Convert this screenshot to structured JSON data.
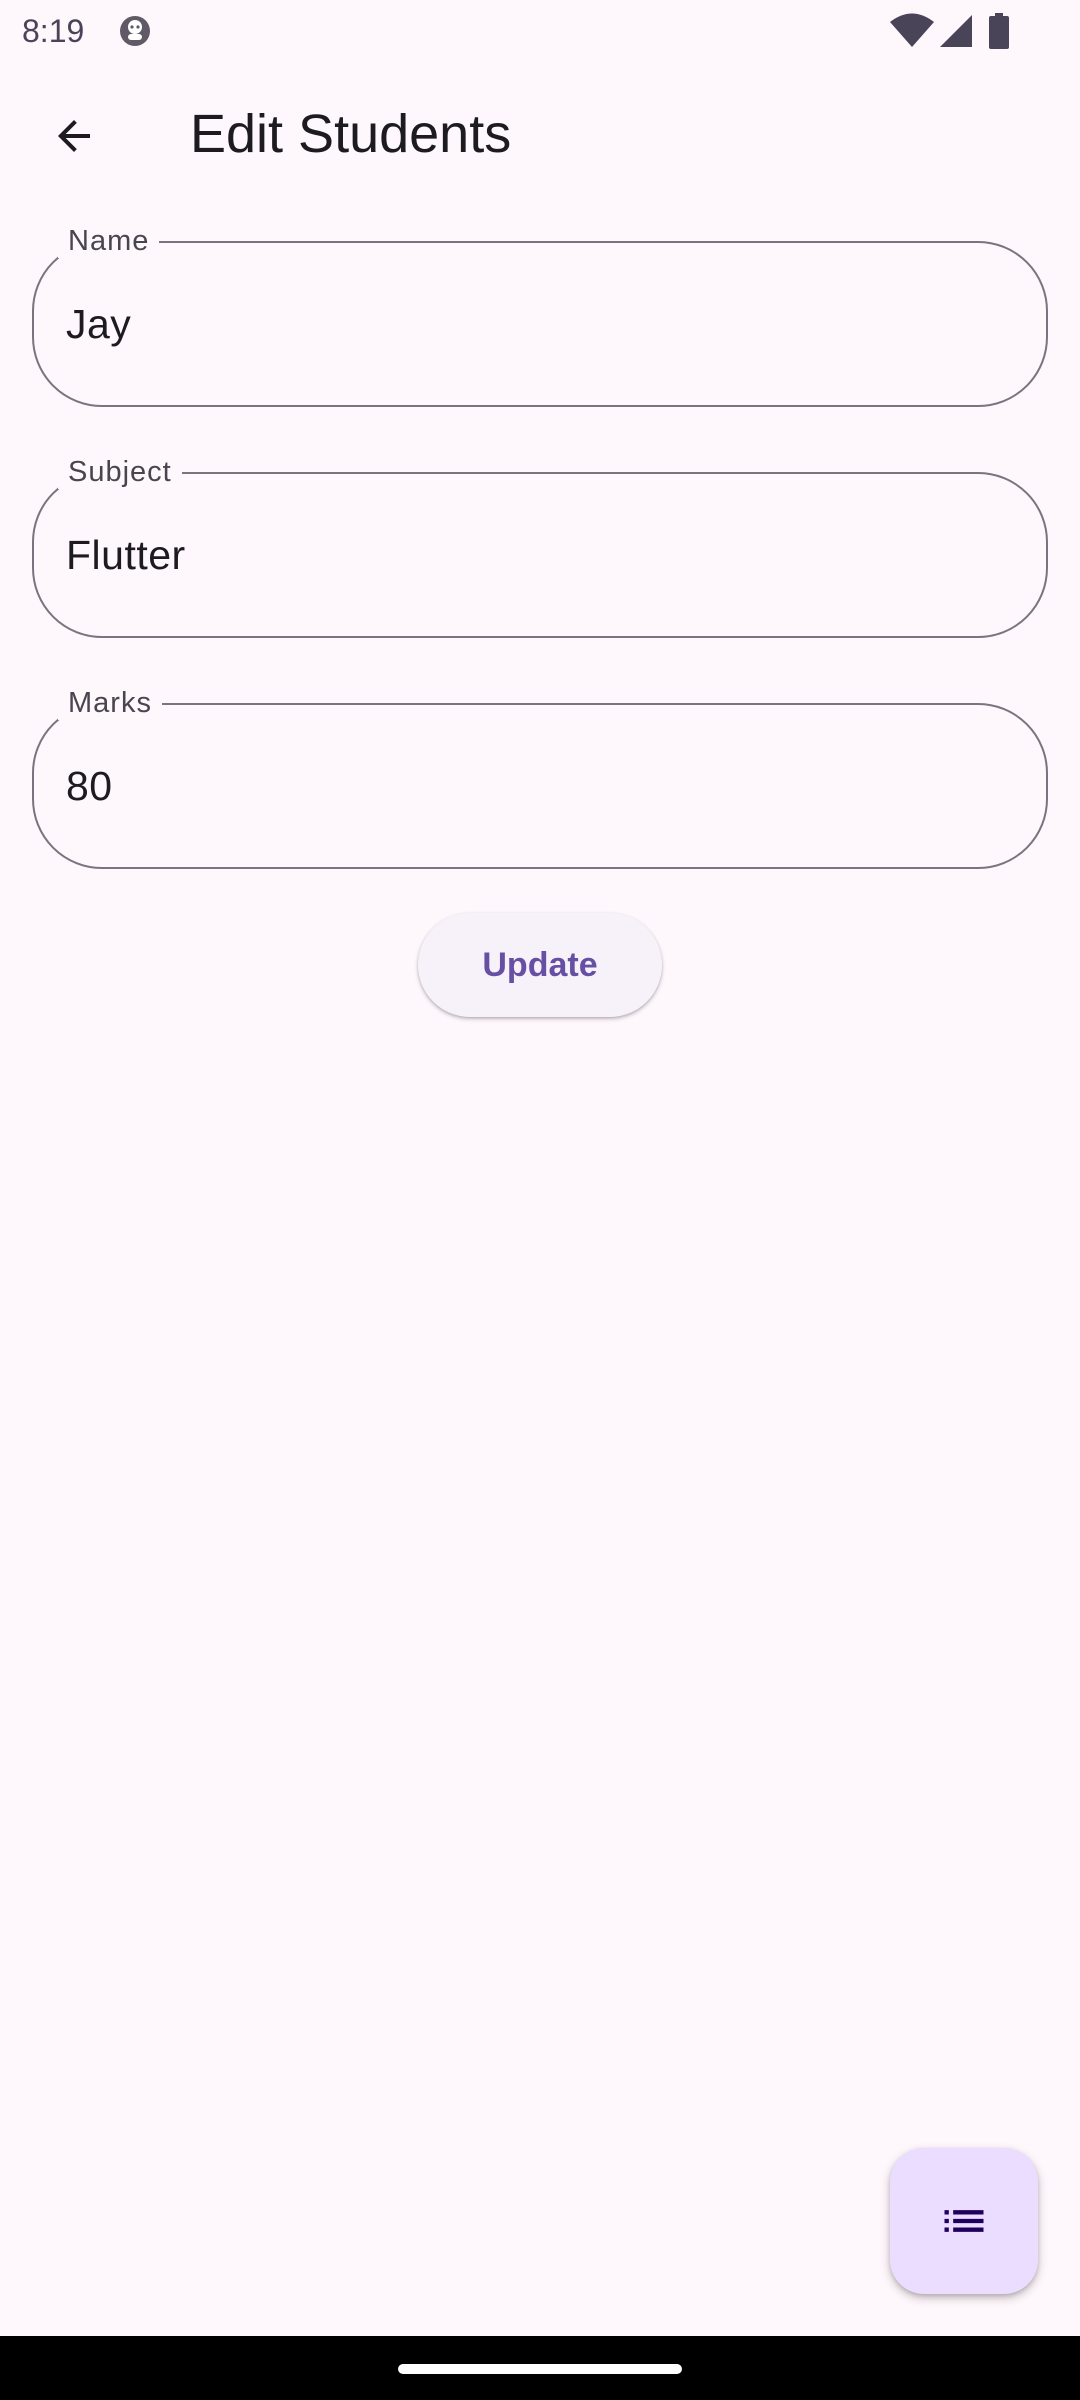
{
  "status_bar": {
    "time": "8:19",
    "icons": [
      "app-notification-icon",
      "wifi-icon",
      "cell-signal-icon",
      "battery-icon"
    ]
  },
  "app_bar": {
    "title": "Edit Students",
    "back_icon": "arrow-back-icon"
  },
  "form": {
    "name": {
      "label": "Name",
      "value": "Jay"
    },
    "subject": {
      "label": "Subject",
      "value": "Flutter"
    },
    "marks": {
      "label": "Marks",
      "value": "80"
    }
  },
  "update_button": {
    "label": "Update"
  },
  "fab": {
    "icon": "list-icon"
  },
  "colors": {
    "background": "#fef7fc",
    "outline": "#79747e",
    "primary": "#6750a4",
    "fab_container": "#eaddff",
    "fab_icon": "#21005d"
  }
}
